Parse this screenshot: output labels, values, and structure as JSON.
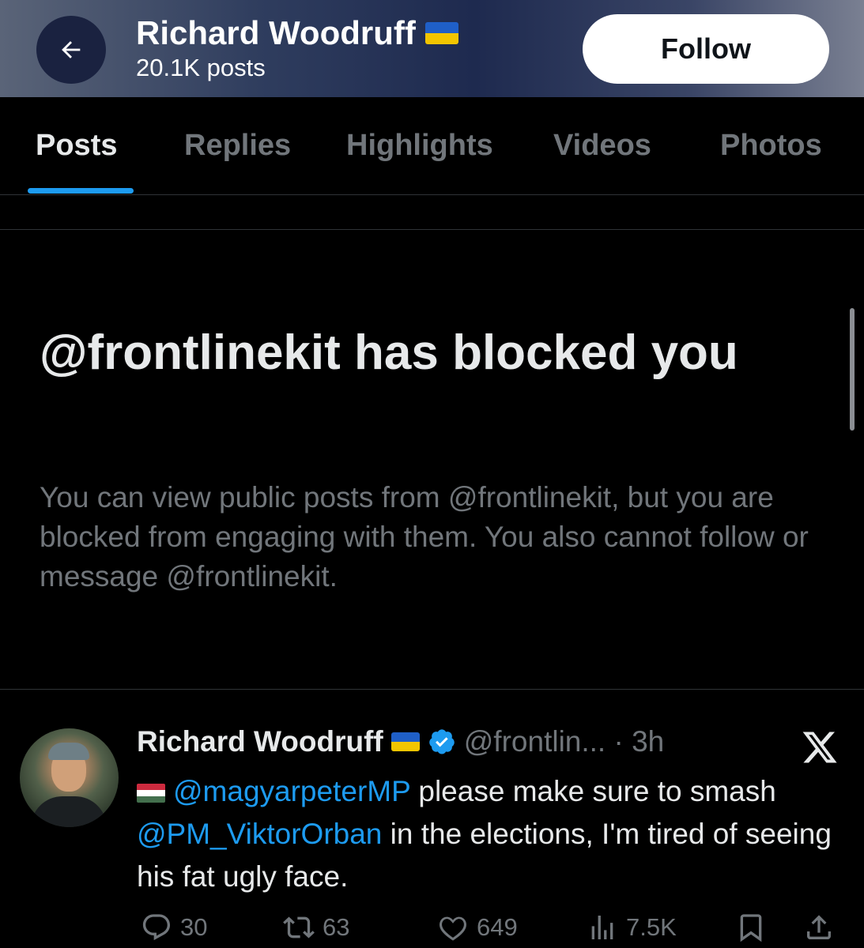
{
  "header": {
    "title": "Richard Woodruff",
    "flag": "ukraine-flag",
    "post_count": "20.1K posts",
    "follow_label": "Follow",
    "colors": {
      "flag_blue": "#1f5fc8",
      "flag_yellow": "#f2c500"
    }
  },
  "tabs": [
    {
      "label": "Posts",
      "active": true
    },
    {
      "label": "Replies",
      "active": false
    },
    {
      "label": "Highlights",
      "active": false
    },
    {
      "label": "Videos",
      "active": false
    },
    {
      "label": "Photos",
      "active": false
    }
  ],
  "blocked": {
    "title": "@frontlinekit has blocked you",
    "description": "You can view public posts from @frontlinekit, but you are blocked from engaging with them. You also cannot follow or message @frontlinekit."
  },
  "tweet": {
    "author_name": "Richard Woodruff",
    "flag": "ukraine-flag",
    "verified": true,
    "handle_time": "@frontlin... · 3h",
    "text_flag": "hungary-flag",
    "mention1": "@magyarpeterMP",
    "text1": " please make sure to smash ",
    "mention2": "@PM_ViktorOrban",
    "text2": " in the elections, I'm tired of seeing his fat ugly face.",
    "actions": {
      "replies": "30",
      "reposts": "63",
      "likes": "649",
      "views": "7.5K"
    }
  },
  "colors": {
    "accent": "#1d9bf0",
    "background": "#000000",
    "muted_text": "#71767b"
  }
}
